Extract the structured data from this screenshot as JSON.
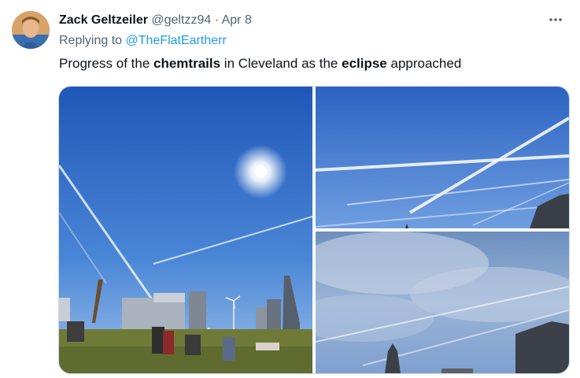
{
  "author": {
    "name": "Zack Geltzeiler",
    "handle": "@geltzz94",
    "separator": "·",
    "date": "Apr 8"
  },
  "reply": {
    "prefix": "Replying to",
    "mention": "@TheFlatEartherr"
  },
  "tweet": {
    "part1": "Progress of the ",
    "bold1": "chemtrails",
    "part2": " in Cleveland as the ",
    "bold2": "eclipse",
    "part3": " approached"
  },
  "more_icon": "more-horizontal-icon",
  "colors": {
    "link": "#1d9bf0",
    "muted": "#536471",
    "sky": "#3f74c9",
    "grass": "#6f7a39"
  }
}
